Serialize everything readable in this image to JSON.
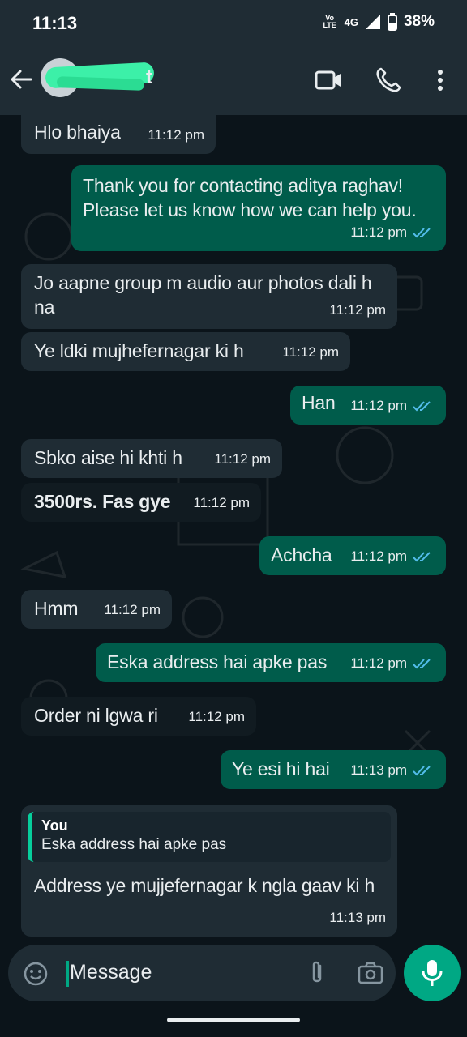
{
  "status_bar": {
    "time": "11:13",
    "volte": "Vo LTE",
    "network": "4G",
    "battery": "38%"
  },
  "header": {
    "contact_name_visible": "t"
  },
  "messages": [
    {
      "dir": "in",
      "text": "Hlo bhaiya",
      "time": "11:12 pm"
    },
    {
      "dir": "out",
      "text": "Thank you for contacting aditya raghav! Please let us know how we can help you.",
      "time": "11:12 pm"
    },
    {
      "dir": "in",
      "text": "Jo aapne group m audio aur photos dali h na",
      "time": "11:12 pm"
    },
    {
      "dir": "in",
      "text": "Ye ldki mujhefernagar ki h",
      "time": "11:12 pm"
    },
    {
      "dir": "out",
      "text": "Han",
      "time": "11:12 pm"
    },
    {
      "dir": "in",
      "text": "Sbko aise hi khti h",
      "time": "11:12 pm"
    },
    {
      "dir": "in",
      "text": "3500rs. Fas gye",
      "time": "11:12 pm"
    },
    {
      "dir": "out",
      "text": "Achcha",
      "time": "11:12 pm"
    },
    {
      "dir": "in",
      "text": "Hmm",
      "time": "11:12 pm"
    },
    {
      "dir": "out",
      "text": "Eska address hai apke pas",
      "time": "11:12 pm"
    },
    {
      "dir": "in",
      "text": "Order ni lgwa ri",
      "time": "11:12 pm"
    },
    {
      "dir": "out",
      "text": "Ye esi hi hai",
      "time": "11:13 pm"
    },
    {
      "dir": "in",
      "reply_author": "You",
      "reply_text": "Eska address hai apke pas",
      "text": "Address ye mujjefernagar k ngla gaav ki h",
      "time": "11:13 pm"
    }
  ],
  "composer": {
    "placeholder": "Message"
  },
  "colors": {
    "accent": "#00a884",
    "outgoing": "#005c4b",
    "incoming": "#1f2c34",
    "tick": "#53bdeb"
  }
}
